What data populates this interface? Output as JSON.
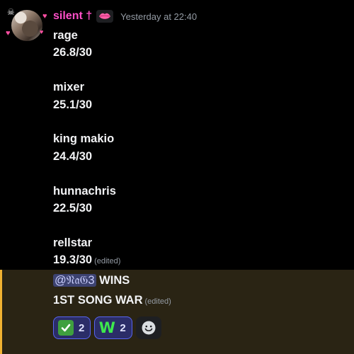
{
  "author": {
    "name": "silent †",
    "role_icon": "pink-lips-icon",
    "timestamp": "Yesterday at 22:40",
    "avatar_decorations": [
      "skull-icon",
      "heart-icon",
      "heart-icon",
      "heart-icon"
    ]
  },
  "lines": {
    "l1": "rage",
    "l2": "26.8/30",
    "l3": "mixer",
    "l4": "25.1/30",
    "l5": "king makio",
    "l6": "24.4/30",
    "l7": "hunnachris",
    "l8": "22.5/30",
    "l9": "rellstar",
    "l10": "19.3/30"
  },
  "edited_label": "(edited)",
  "mention": {
    "user": "@𝔑𝔞𝔊3",
    "after_mention": " WINS",
    "line2": "1ST SONG WAR"
  },
  "reactions": [
    {
      "emoji": "white-check-mark-icon",
      "count": "2"
    },
    {
      "emoji": "green-w-icon",
      "glyph": "W",
      "count": "2"
    }
  ],
  "add_reaction_icon": "smiley-add-reaction-icon",
  "colors": {
    "username": "#ff4fc8",
    "mention_bar": "#f0b232",
    "mention_background": "#2a2414",
    "reaction_border": "#5865f2"
  }
}
